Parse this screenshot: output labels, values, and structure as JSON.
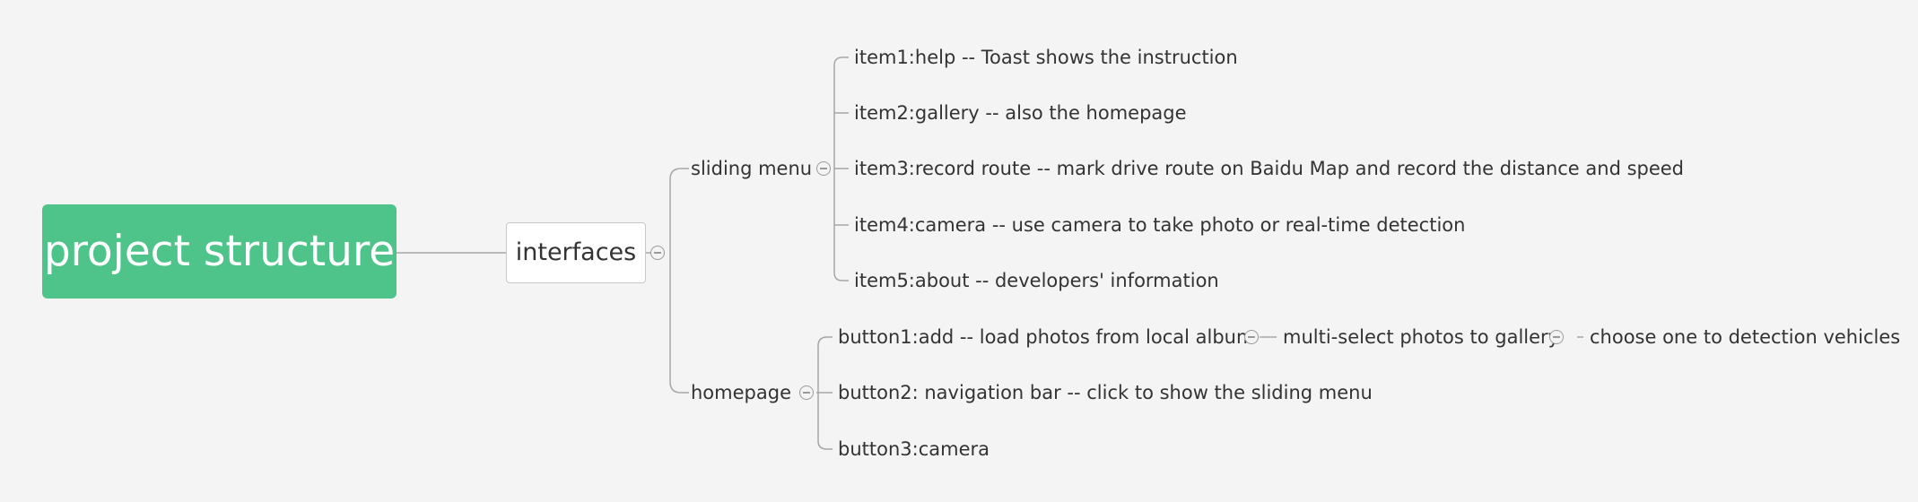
{
  "root": {
    "label": "project structure"
  },
  "interfaces": {
    "label": "interfaces"
  },
  "sliding_menu": {
    "label": "sliding menu",
    "items": [
      "item1:help -- Toast shows the instruction",
      "item2:gallery -- also the homepage",
      "item3:record route -- mark drive route on Baidu Map and record the distance and speed",
      "item4:camera -- use camera to take photo or real-time detection",
      "item5:about -- developers' information"
    ]
  },
  "homepage": {
    "label": "homepage",
    "buttons": [
      "button1:add -- load photos from local album",
      "button2: navigation bar -- click to show the sliding menu",
      "button3:camera"
    ],
    "add_chain": [
      "multi-select photos to gallery",
      "choose one to detection vehicles"
    ]
  },
  "colors": {
    "root_fill": "#4ec48a",
    "background": "#f4f4f4",
    "connector": "#a6a6a6"
  }
}
